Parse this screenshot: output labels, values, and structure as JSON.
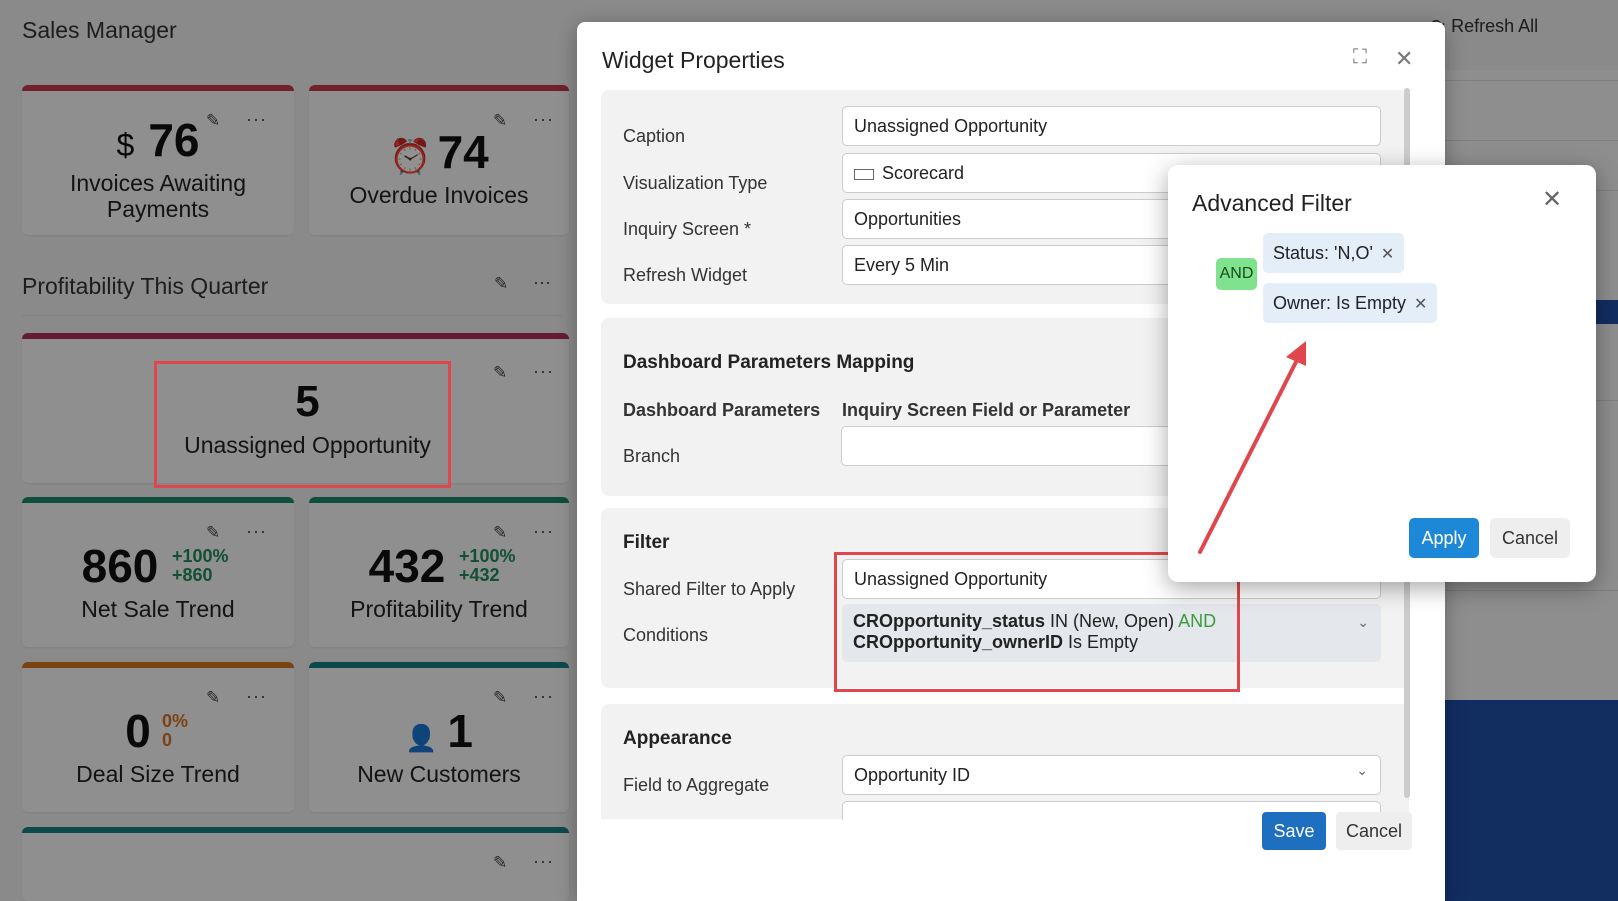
{
  "app": {
    "title": "Sales Manager",
    "refresh_label": "Refresh All"
  },
  "cards": {
    "invoices": {
      "prefix": "$",
      "value": "76",
      "label": "Invoices Awaiting Payments"
    },
    "overdue": {
      "value": "74",
      "label": "Overdue Invoices"
    },
    "section_title": "Profitability This Quarter",
    "unassigned": {
      "value": "5",
      "label": "Unassigned Opportunity"
    },
    "net_sale": {
      "value": "860",
      "trend_pct": "+100%",
      "trend_abs": "+860",
      "label": "Net Sale Trend"
    },
    "profitability": {
      "value": "432",
      "trend_pct": "+100%",
      "trend_abs": "+432",
      "label": "Profitability Trend"
    },
    "deal_size": {
      "value": "0",
      "trend_pct": "0%",
      "trend_abs": "0",
      "label": "Deal Size Trend"
    },
    "new_customers": {
      "value": "1",
      "label": "New Customers"
    },
    "dots": "···"
  },
  "dialog": {
    "title": "Widget Properties",
    "fields": {
      "caption_label": "Caption",
      "caption_value": "Unassigned Opportunity",
      "viz_label": "Visualization Type",
      "viz_value": "Scorecard",
      "inquiry_label": "Inquiry Screen *",
      "inquiry_value": "Opportunities",
      "refresh_label": "Refresh Widget",
      "refresh_value": "Every 5 Min"
    },
    "mapping": {
      "title": "Dashboard Parameters Mapping",
      "col1": "Dashboard Parameters",
      "col2": "Inquiry Screen Field or Parameter",
      "branch_label": "Branch"
    },
    "filter": {
      "title": "Filter",
      "shared_label": "Shared Filter to Apply",
      "shared_value": "Unassigned Opportunity",
      "conditions_label": "Conditions",
      "cond1_field": "CROpportunity_status",
      "cond1_rest": "IN (New, Open)",
      "cond_and": "AND",
      "cond2_field": "CROpportunity_ownerID",
      "cond2_rest": "Is Empty"
    },
    "appearance": {
      "title": "Appearance",
      "aggregate_label": "Field to Aggregate",
      "aggregate_value": "Opportunity ID"
    },
    "save_label": "Save",
    "cancel_label": "Cancel"
  },
  "advanced_filter": {
    "title": "Advanced Filter",
    "operator": "AND",
    "chip1": "Status: 'N,O'",
    "chip2": "Owner: Is Empty",
    "apply_label": "Apply",
    "cancel_label": "Cancel"
  },
  "colors": {
    "accent": "#1e88d8",
    "annotation": "#e0474c",
    "and_badge": "#7fe28f",
    "trend_green": "#1f8a5b",
    "trend_orange": "#d4731f"
  }
}
